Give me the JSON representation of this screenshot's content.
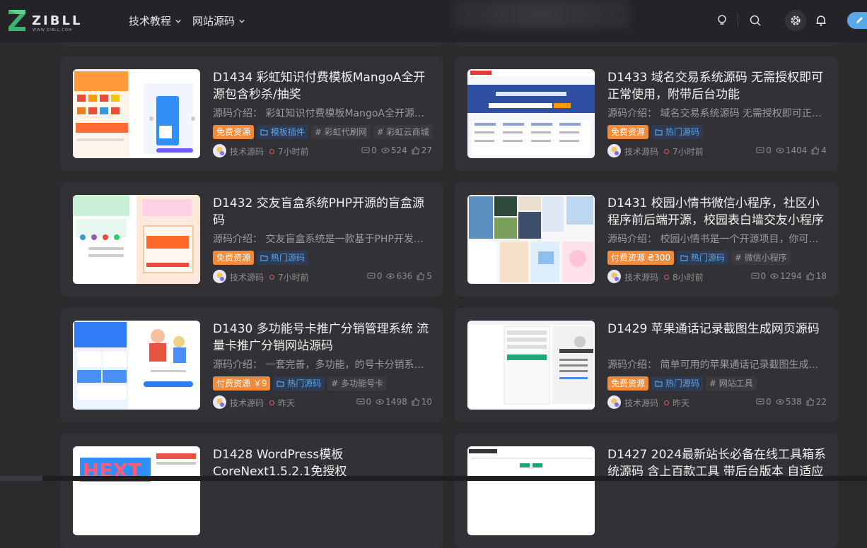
{
  "header": {
    "logo_text": "ZIBLL",
    "logo_sub": "WWW.ZIBLL.COM",
    "nav": [
      {
        "label": "技术教程"
      },
      {
        "label": "网站源码"
      }
    ]
  },
  "cards": [
    {
      "title": "D1434 彩虹知识付费模板MangoA全开源包含秒杀/抽奖",
      "desc": "源码介绍： 彩虹知识付费模板MangoA全开源包含秒杀/抽奖",
      "tags": [
        {
          "type": "free",
          "label": "免费资源"
        },
        {
          "type": "cat",
          "label": "模板插件"
        },
        {
          "type": "topic",
          "label": "# 彩虹代刷网"
        },
        {
          "type": "topic",
          "label": "# 彩虹云商城"
        }
      ],
      "author": "技术源码",
      "time": "7小时前",
      "comments": "0",
      "views": "524",
      "likes": "27"
    },
    {
      "title": "D1433 域名交易系统源码 无需授权即可正常使用，附带后台功能",
      "desc": "源码介绍： 域名交易系统源码 无需授权即可正常使用",
      "tags": [
        {
          "type": "free",
          "label": "免费资源"
        },
        {
          "type": "cat",
          "label": "热门源码"
        }
      ],
      "author": "技术源码",
      "time": "7小时前",
      "comments": "0",
      "views": "1404",
      "likes": "4"
    },
    {
      "title": "D1432 交友盲盒系统PHP开源的盲盒源码",
      "desc": "源码介绍： 交友盲盒系统是一款基于PHP开发的开源盲盒",
      "tags": [
        {
          "type": "free",
          "label": "免费资源"
        },
        {
          "type": "cat",
          "label": "热门源码"
        }
      ],
      "author": "技术源码",
      "time": "7小时前",
      "comments": "0",
      "views": "636",
      "likes": "5"
    },
    {
      "title": "D1431 校园小情书微信小程序，社区小程序前后端开源，校园表白墙交友小程序",
      "desc": "源码介绍： 校园小情书是一个开源项目，你可以使用它",
      "tags": [
        {
          "type": "paid",
          "label": "付费资源 ₴300"
        },
        {
          "type": "cat",
          "label": "热门源码"
        },
        {
          "type": "topic",
          "label": "# 微信小程序"
        }
      ],
      "author": "技术源码",
      "time": "8小时前",
      "comments": "0",
      "views": "1294",
      "likes": "18"
    },
    {
      "title": "D1430 多功能号卡推广分销管理系统 流量卡推广分销网站源码",
      "desc": "源码介绍： 一套完善，多功能，的号卡分销系统，多接口",
      "tags": [
        {
          "type": "paid",
          "label": "付费资源 ￥9"
        },
        {
          "type": "cat",
          "label": "热门源码"
        },
        {
          "type": "topic",
          "label": "# 多功能号卡"
        }
      ],
      "author": "技术源码",
      "time": "昨天",
      "comments": "0",
      "views": "1498",
      "likes": "10"
    },
    {
      "title": "D1429 苹果通话记录截图生成网页源码",
      "desc": "源码介绍： 简单可用的苹果通话记录截图生成工具源码",
      "tags": [
        {
          "type": "free",
          "label": "免费资源"
        },
        {
          "type": "cat",
          "label": "热门源码"
        },
        {
          "type": "topic",
          "label": "# 网站工具"
        }
      ],
      "author": "技术源码",
      "time": "昨天",
      "comments": "0",
      "views": "538",
      "likes": "22"
    },
    {
      "title": "D1428 WordPress模板CoreNext1.5.2.1免授权",
      "desc": "",
      "tags": [],
      "author": "",
      "time": "",
      "comments": "",
      "views": "",
      "likes": ""
    },
    {
      "title": "D1427 2024最新站长必备在线工具箱系统源码 含上百款工具 带后台版本 自适应",
      "desc": "",
      "tags": [],
      "author": "",
      "time": "",
      "comments": "",
      "views": "",
      "likes": ""
    }
  ]
}
